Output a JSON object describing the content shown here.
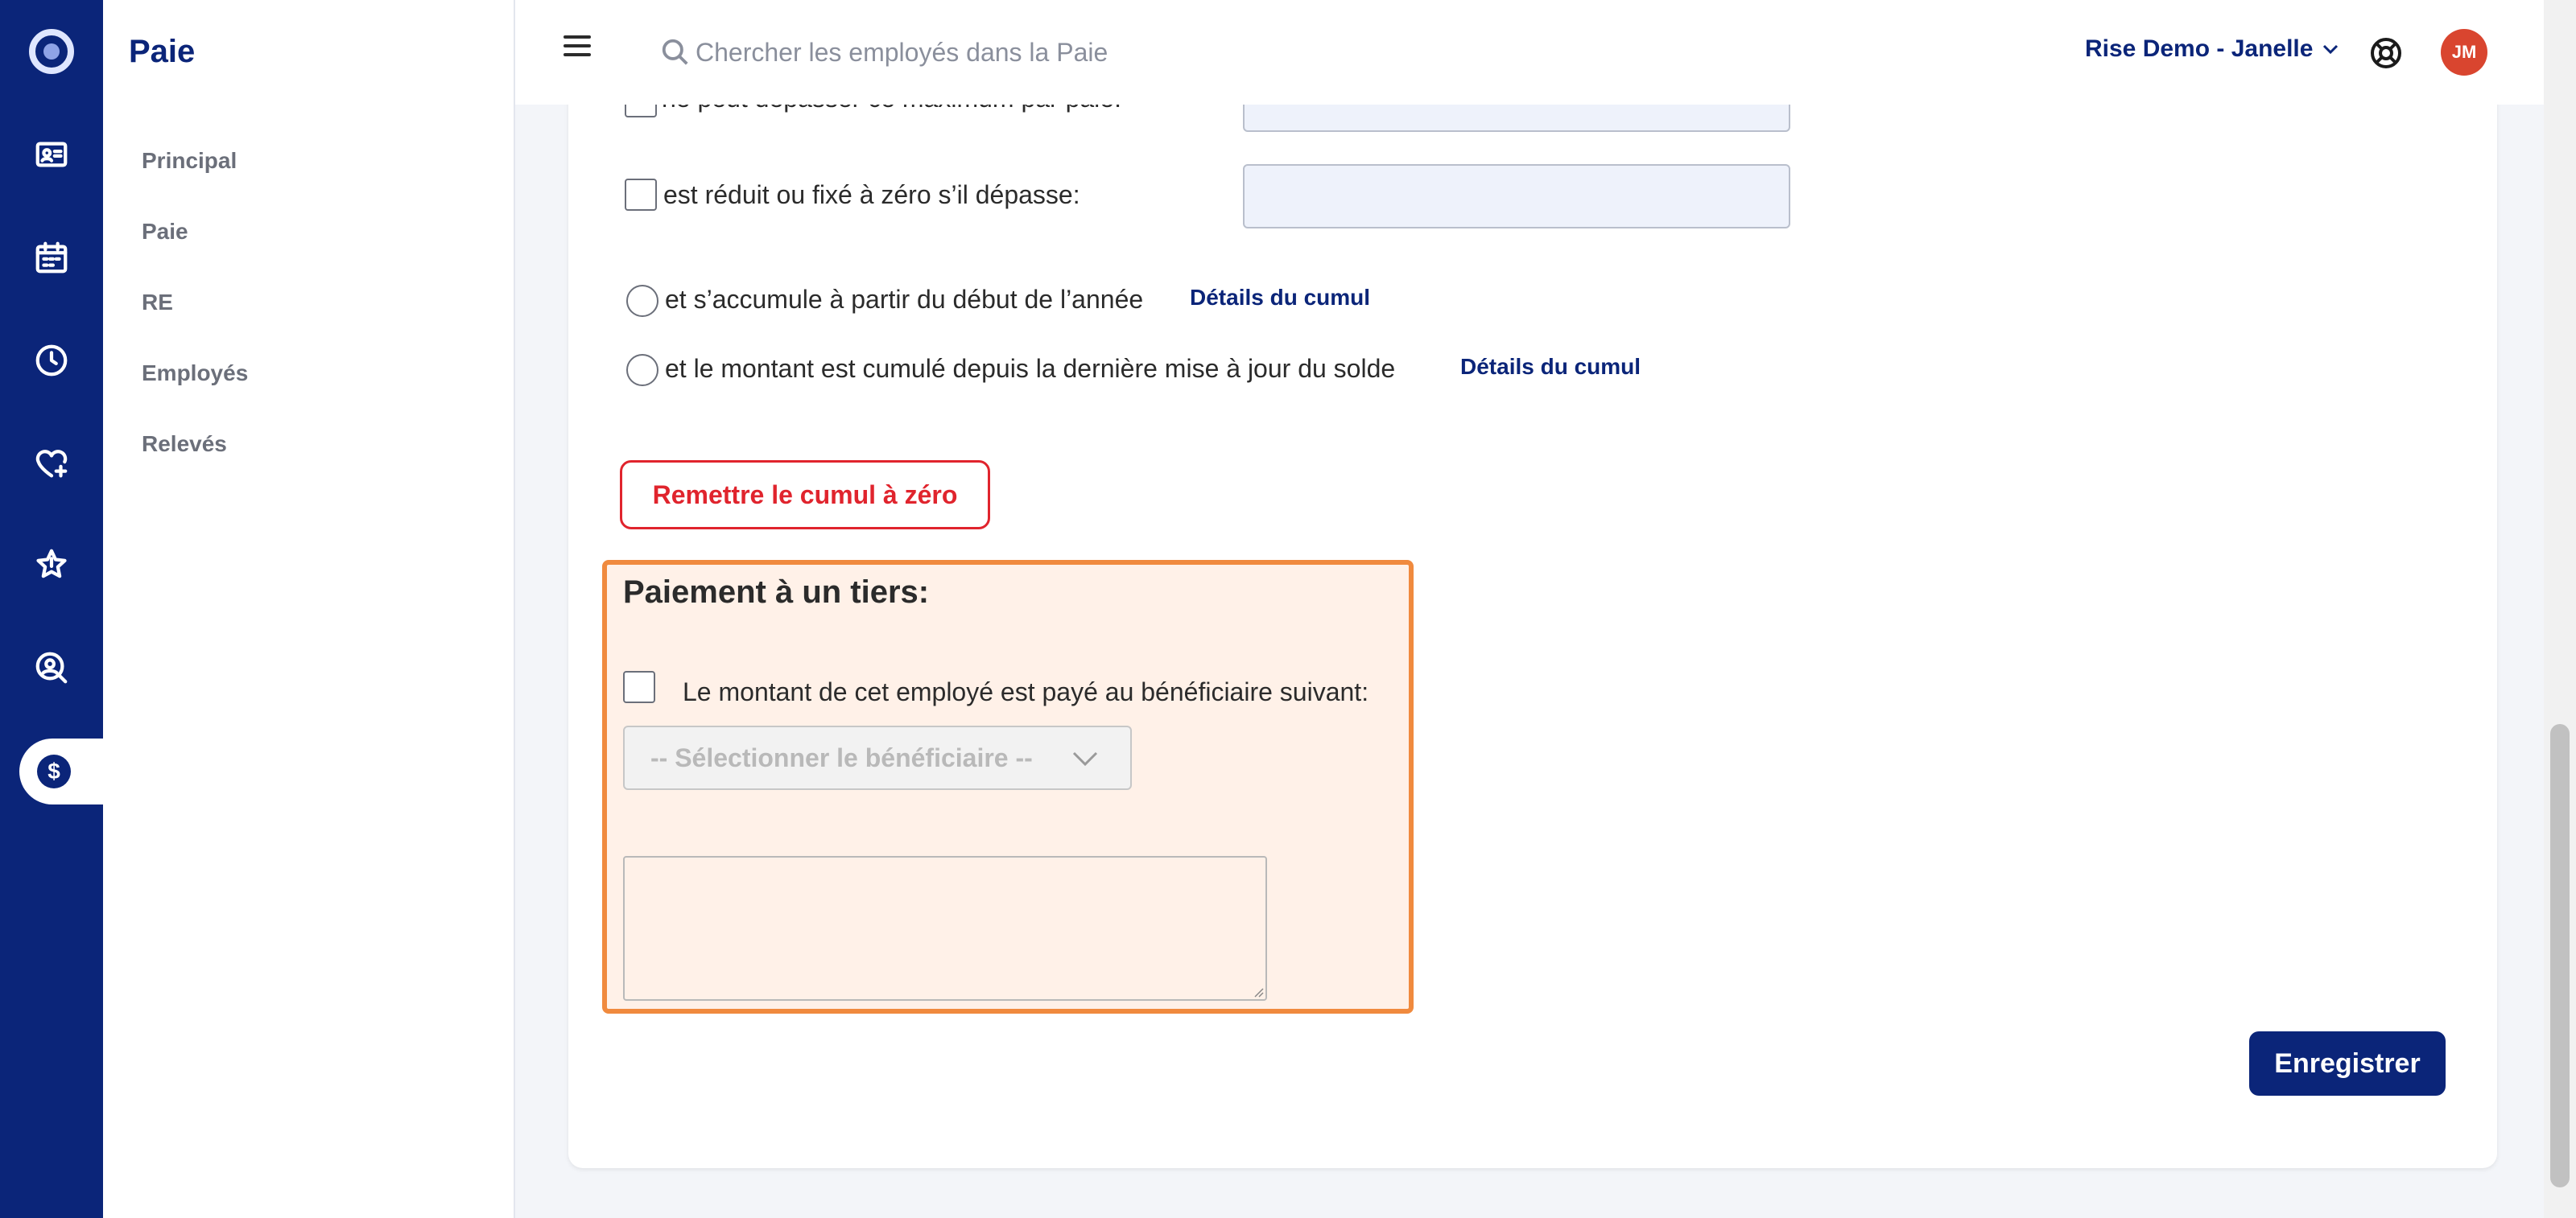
{
  "app": {
    "section_title": "Paie"
  },
  "rail": {
    "items": [
      {
        "icon": "logo-icon"
      },
      {
        "icon": "id-card-icon"
      },
      {
        "icon": "calendar-icon"
      },
      {
        "icon": "clock-icon"
      },
      {
        "icon": "heart-plus-icon"
      },
      {
        "icon": "star-icon"
      },
      {
        "icon": "person-search-icon"
      },
      {
        "icon": "dollar-icon",
        "active": true
      }
    ]
  },
  "sidebar": {
    "title": "Paie",
    "items": [
      {
        "label": "Principal"
      },
      {
        "label": "Paie"
      },
      {
        "label": "RE"
      },
      {
        "label": "Employés"
      },
      {
        "label": "Relevés"
      }
    ]
  },
  "header": {
    "search_placeholder": "Chercher les employés dans la Paie",
    "account_label": "Rise Demo - Janelle",
    "avatar_initials": "JM"
  },
  "form": {
    "partial_label": "ne peut dépasser ce maximum par paie:",
    "reduce_label": "est réduit ou fixé à zéro s’il dépasse:",
    "accumulate_year_label": "et s’accumule à partir du début de l’année",
    "accumulate_year_link": "Détails du cumul",
    "accumulate_balance_label": "et le montant est cumulé depuis la dernière mise à jour du solde",
    "accumulate_balance_link": "Détails du cumul",
    "reset_button": "Remettre le cumul à zéro",
    "save_button": "Enregistrer"
  },
  "third_party": {
    "title": "Paiement à un tiers:",
    "checkbox_label": "Le montant de cet employé est payé au bénéficiaire suivant:",
    "select_value": "-- Sélectionner le bénéficiaire --",
    "notes_value": ""
  },
  "colors": {
    "brand": "#0b2579",
    "danger": "#e0242d",
    "highlight_border": "#f08a3e",
    "highlight_fill": "#fff1e8",
    "avatar": "#d9452f"
  }
}
